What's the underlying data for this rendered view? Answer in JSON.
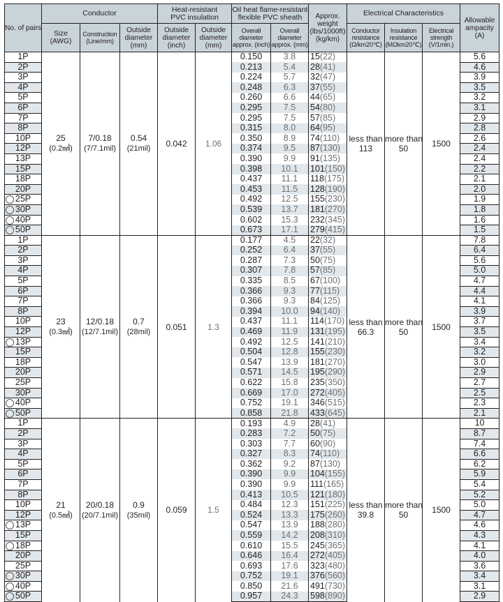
{
  "headers": {
    "pairs": "No. of pairs",
    "conductor": "Conductor",
    "size": [
      "Size",
      "(AWG)"
    ],
    "construction": [
      "Construction",
      "(Line/mm)"
    ],
    "cond_od": [
      "Outside",
      "diameter",
      "(mm)"
    ],
    "insulation": [
      "Heat-resistant",
      "PVC insulation"
    ],
    "ins_od_inch": [
      "Outside",
      "diameter",
      "(inch)"
    ],
    "ins_od_mm": [
      "Outside",
      "diameter",
      "(mm)"
    ],
    "sheath": [
      "Oil heat flame-resistant",
      "flexible PVC sheath"
    ],
    "sheath_inch": [
      "Overall",
      "diameter",
      "approx. (inch)"
    ],
    "sheath_mm": [
      "Overall",
      "diameter",
      "approx. (mm)"
    ],
    "weight": [
      "Approx.",
      "weight",
      "(lbs/1000ft)",
      "(kg/km)"
    ],
    "electrical": "Electrical Characteristics",
    "cond_res": [
      "Conductor",
      "resistance",
      "(Ω/km20℃)"
    ],
    "ins_res": [
      "Insulation",
      "resistance",
      "(MΩkm20℃)"
    ],
    "strength": [
      "Electrical",
      "strength",
      "(V/1min.)"
    ],
    "ampacity": [
      "Allowable",
      "ampacity",
      "(A)"
    ]
  },
  "groups": [
    {
      "size": "25",
      "size_sub": "(0.2㎟)",
      "construction": "7/0.18",
      "construction_sub": "(7/7.1mil)",
      "cond_od": "0.54",
      "cond_od_sub": "(21mil)",
      "ins_od_inch": "0.042",
      "ins_od_mm": "1.06",
      "cond_res": [
        "less than",
        "113"
      ],
      "ins_res": [
        "more than",
        "50"
      ],
      "strength": "1500",
      "rows": [
        {
          "pairs": "1P",
          "mark": false,
          "inch": "0.150",
          "mm": "3.8",
          "lbs": "15",
          "kg": "(22)",
          "amp": "5.6"
        },
        {
          "pairs": "2P",
          "mark": false,
          "inch": "0.213",
          "mm": "5.4",
          "lbs": "28",
          "kg": "(41)",
          "amp": "4.6"
        },
        {
          "pairs": "3P",
          "mark": false,
          "inch": "0.224",
          "mm": "5.7",
          "lbs": "32",
          "kg": "(47)",
          "amp": "3.9"
        },
        {
          "pairs": "4P",
          "mark": false,
          "inch": "0.248",
          "mm": "6.3",
          "lbs": "37",
          "kg": "(55)",
          "amp": "3.5"
        },
        {
          "pairs": "5P",
          "mark": false,
          "inch": "0.260",
          "mm": "6.6",
          "lbs": "44",
          "kg": "(65)",
          "amp": "3.2"
        },
        {
          "pairs": "6P",
          "mark": false,
          "inch": "0.295",
          "mm": "7.5",
          "lbs": "54",
          "kg": "(80)",
          "amp": "3.1"
        },
        {
          "pairs": "7P",
          "mark": false,
          "inch": "0.295",
          "mm": "7.5",
          "lbs": "57",
          "kg": "(85)",
          "amp": "2.9"
        },
        {
          "pairs": "8P",
          "mark": false,
          "inch": "0.315",
          "mm": "8.0",
          "lbs": "64",
          "kg": "(95)",
          "amp": "2.8"
        },
        {
          "pairs": "10P",
          "mark": false,
          "inch": "0.350",
          "mm": "8.9",
          "lbs": "74",
          "kg": "(110)",
          "amp": "2.6"
        },
        {
          "pairs": "12P",
          "mark": false,
          "inch": "0.374",
          "mm": "9.5",
          "lbs": "87",
          "kg": "(130)",
          "amp": "2.4"
        },
        {
          "pairs": "13P",
          "mark": false,
          "inch": "0.390",
          "mm": "9.9",
          "lbs": "91",
          "kg": "(135)",
          "amp": "2.4"
        },
        {
          "pairs": "15P",
          "mark": false,
          "inch": "0.398",
          "mm": "10.1",
          "lbs": "101",
          "kg": "(150)",
          "amp": "2.2"
        },
        {
          "pairs": "18P",
          "mark": false,
          "inch": "0.437",
          "mm": "11.1",
          "lbs": "118",
          "kg": "(175)",
          "amp": "2.1"
        },
        {
          "pairs": "20P",
          "mark": false,
          "inch": "0.453",
          "mm": "11.5",
          "lbs": "128",
          "kg": "(190)",
          "amp": "2.0"
        },
        {
          "pairs": "25P",
          "mark": true,
          "inch": "0.492",
          "mm": "12.5",
          "lbs": "155",
          "kg": "(230)",
          "amp": "1.9"
        },
        {
          "pairs": "30P",
          "mark": true,
          "inch": "0.539",
          "mm": "13.7",
          "lbs": "181",
          "kg": "(270)",
          "amp": "1.8"
        },
        {
          "pairs": "40P",
          "mark": true,
          "inch": "0.602",
          "mm": "15.3",
          "lbs": "232",
          "kg": "(345)",
          "amp": "1.6"
        },
        {
          "pairs": "50P",
          "mark": true,
          "inch": "0.673",
          "mm": "17.1",
          "lbs": "279",
          "kg": "(415)",
          "amp": "1.5"
        }
      ]
    },
    {
      "size": "23",
      "size_sub": "(0.3㎟)",
      "construction": "12/0.18",
      "construction_sub": "(12/7.1mil)",
      "cond_od": "0.7",
      "cond_od_sub": "(28mil)",
      "ins_od_inch": "0.051",
      "ins_od_mm": "1.3",
      "cond_res": [
        "less than",
        "66.3"
      ],
      "ins_res": [
        "more than",
        "50"
      ],
      "strength": "1500",
      "rows": [
        {
          "pairs": "1P",
          "mark": false,
          "inch": "0.177",
          "mm": "4.5",
          "lbs": "22",
          "kg": "(32)",
          "amp": "7.8"
        },
        {
          "pairs": "2P",
          "mark": false,
          "inch": "0.252",
          "mm": "6.4",
          "lbs": "37",
          "kg": "(55)",
          "amp": "6.4"
        },
        {
          "pairs": "3P",
          "mark": false,
          "inch": "0.287",
          "mm": "7.3",
          "lbs": "50",
          "kg": "(75)",
          "amp": "5.6"
        },
        {
          "pairs": "4P",
          "mark": false,
          "inch": "0.307",
          "mm": "7.8",
          "lbs": "57",
          "kg": "(85)",
          "amp": "5.0"
        },
        {
          "pairs": "5P",
          "mark": false,
          "inch": "0.335",
          "mm": "8.5",
          "lbs": "67",
          "kg": "(100)",
          "amp": "4.7"
        },
        {
          "pairs": "6P",
          "mark": false,
          "inch": "0.366",
          "mm": "9.3",
          "lbs": "77",
          "kg": "(115)",
          "amp": "4.4"
        },
        {
          "pairs": "7P",
          "mark": false,
          "inch": "0.366",
          "mm": "9.3",
          "lbs": "84",
          "kg": "(125)",
          "amp": "4.1"
        },
        {
          "pairs": "8P",
          "mark": false,
          "inch": "0.394",
          "mm": "10.0",
          "lbs": "94",
          "kg": "(140)",
          "amp": "3.9"
        },
        {
          "pairs": "10P",
          "mark": false,
          "inch": "0.437",
          "mm": "11.1",
          "lbs": "114",
          "kg": "(170)",
          "amp": "3.7"
        },
        {
          "pairs": "12P",
          "mark": false,
          "inch": "0.469",
          "mm": "11.9",
          "lbs": "131",
          "kg": "(195)",
          "amp": "3.5"
        },
        {
          "pairs": "13P",
          "mark": true,
          "inch": "0.492",
          "mm": "12.5",
          "lbs": "141",
          "kg": "(210)",
          "amp": "3.4"
        },
        {
          "pairs": "15P",
          "mark": false,
          "inch": "0.504",
          "mm": "12.8",
          "lbs": "155",
          "kg": "(230)",
          "amp": "3.2"
        },
        {
          "pairs": "18P",
          "mark": false,
          "inch": "0.547",
          "mm": "13.9",
          "lbs": "181",
          "kg": "(270)",
          "amp": "3.0"
        },
        {
          "pairs": "20P",
          "mark": false,
          "inch": "0.571",
          "mm": "14.5",
          "lbs": "195",
          "kg": "(290)",
          "amp": "2.9"
        },
        {
          "pairs": "25P",
          "mark": false,
          "inch": "0.622",
          "mm": "15.8",
          "lbs": "235",
          "kg": "(350)",
          "amp": "2.7"
        },
        {
          "pairs": "30P",
          "mark": false,
          "inch": "0.669",
          "mm": "17.0",
          "lbs": "272",
          "kg": "(405)",
          "amp": "2.5"
        },
        {
          "pairs": "40P",
          "mark": true,
          "inch": "0.752",
          "mm": "19.1",
          "lbs": "346",
          "kg": "(515)",
          "amp": "2.3"
        },
        {
          "pairs": "50P",
          "mark": true,
          "inch": "0.858",
          "mm": "21.8",
          "lbs": "433",
          "kg": "(645)",
          "amp": "2.1"
        }
      ]
    },
    {
      "size": "21",
      "size_sub": "(0.5㎟)",
      "construction": "20/0.18",
      "construction_sub": "(20/7.1mil)",
      "cond_od": "0.9",
      "cond_od_sub": "(35mil)",
      "ins_od_inch": "0.059",
      "ins_od_mm": "1.5",
      "cond_res": [
        "less than",
        "39.8"
      ],
      "ins_res": [
        "more than",
        "50"
      ],
      "strength": "1500",
      "rows": [
        {
          "pairs": "1P",
          "mark": false,
          "inch": "0.193",
          "mm": "4.9",
          "lbs": "28",
          "kg": "(41)",
          "amp": "10"
        },
        {
          "pairs": "2P",
          "mark": false,
          "inch": "0.283",
          "mm": "7.2",
          "lbs": "50",
          "kg": "(75)",
          "amp": "8.7"
        },
        {
          "pairs": "3P",
          "mark": false,
          "inch": "0.303",
          "mm": "7.7",
          "lbs": "60",
          "kg": "(90)",
          "amp": "7.4"
        },
        {
          "pairs": "4P",
          "mark": false,
          "inch": "0.327",
          "mm": "8.3",
          "lbs": "74",
          "kg": "(110)",
          "amp": "6.6"
        },
        {
          "pairs": "5P",
          "mark": false,
          "inch": "0.362",
          "mm": "9.2",
          "lbs": "87",
          "kg": "(130)",
          "amp": "6.2"
        },
        {
          "pairs": "6P",
          "mark": false,
          "inch": "0.390",
          "mm": "9.9",
          "lbs": "104",
          "kg": "(155)",
          "amp": "5.9"
        },
        {
          "pairs": "7P",
          "mark": false,
          "inch": "0.390",
          "mm": "9.9",
          "lbs": "111",
          "kg": "(165)",
          "amp": "5.4"
        },
        {
          "pairs": "8P",
          "mark": false,
          "inch": "0.413",
          "mm": "10.5",
          "lbs": "121",
          "kg": "(180)",
          "amp": "5.2"
        },
        {
          "pairs": "10P",
          "mark": false,
          "inch": "0.484",
          "mm": "12.3",
          "lbs": "151",
          "kg": "(225)",
          "amp": "5.0"
        },
        {
          "pairs": "12P",
          "mark": false,
          "inch": "0.524",
          "mm": "13.3",
          "lbs": "175",
          "kg": "(260)",
          "amp": "4.7"
        },
        {
          "pairs": "13P",
          "mark": true,
          "inch": "0.547",
          "mm": "13.9",
          "lbs": "188",
          "kg": "(280)",
          "amp": "4.6"
        },
        {
          "pairs": "15P",
          "mark": false,
          "inch": "0.559",
          "mm": "14.2",
          "lbs": "208",
          "kg": "(310)",
          "amp": "4.3"
        },
        {
          "pairs": "18P",
          "mark": true,
          "inch": "0.610",
          "mm": "15.5",
          "lbs": "245",
          "kg": "(365)",
          "amp": "4.1"
        },
        {
          "pairs": "20P",
          "mark": false,
          "inch": "0.646",
          "mm": "16.4",
          "lbs": "272",
          "kg": "(405)",
          "amp": "4.0"
        },
        {
          "pairs": "25P",
          "mark": false,
          "inch": "0.693",
          "mm": "17.6",
          "lbs": "323",
          "kg": "(480)",
          "amp": "3.6"
        },
        {
          "pairs": "30P",
          "mark": true,
          "inch": "0.752",
          "mm": "19.1",
          "lbs": "376",
          "kg": "(560)",
          "amp": "3.4"
        },
        {
          "pairs": "40P",
          "mark": true,
          "inch": "0.850",
          "mm": "21.6",
          "lbs": "491",
          "kg": "(730)",
          "amp": "3.1"
        },
        {
          "pairs": "50P",
          "mark": true,
          "inch": "0.957",
          "mm": "24.3",
          "lbs": "598",
          "kg": "(890)",
          "amp": "2.9"
        }
      ]
    }
  ]
}
